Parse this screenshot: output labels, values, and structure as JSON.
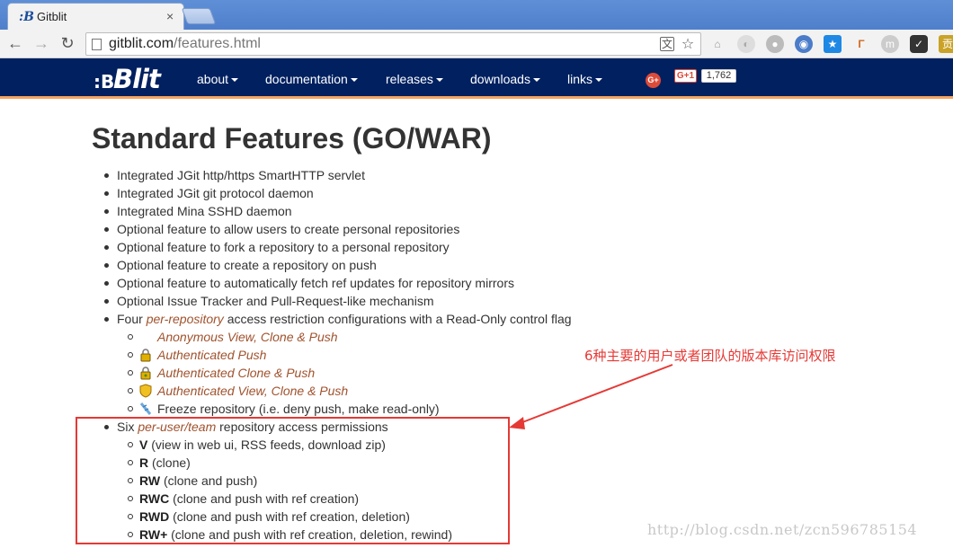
{
  "browser": {
    "tab_title": "Gitblit",
    "tab_close": "×",
    "url_host": "gitblit.com",
    "url_path": "/features.html"
  },
  "site": {
    "brand": "Blit",
    "brand_glyph": "☷",
    "menu": [
      {
        "label": "about"
      },
      {
        "label": "documentation"
      },
      {
        "label": "releases"
      },
      {
        "label": "downloads"
      },
      {
        "label": "links"
      }
    ],
    "gplus_icon": "G+",
    "gplus_button": "G+1",
    "gplus_count": "1,762"
  },
  "content": {
    "title": "Standard Features (GO/WAR)",
    "features": [
      "Integrated JGit http/https SmartHTTP servlet",
      "Integrated JGit git protocol daemon",
      "Integrated Mina SSHD daemon",
      "Optional feature to allow users to create personal repositories",
      "Optional feature to fork a repository to a personal repository",
      "Optional feature to create a repository on push",
      "Optional feature to automatically fetch ref updates for repository mirrors",
      "Optional Issue Tracker and Pull-Request-like mechanism"
    ],
    "per_repo": {
      "prefix": "Four ",
      "emph": "per-repository",
      "suffix": " access restriction configurations with a Read-Only control flag",
      "items": [
        {
          "label": "Anonymous View, Clone & Push",
          "icon": "none"
        },
        {
          "label": "Authenticated Push",
          "icon": "lock-icon"
        },
        {
          "label": "Authenticated Clone & Push",
          "icon": "lock-icon"
        },
        {
          "label": "Authenticated View, Clone & Push",
          "icon": "shield-icon"
        },
        {
          "label": "Freeze repository (i.e. deny push, make read-only)",
          "icon": "cold-icon"
        }
      ]
    },
    "per_user": {
      "prefix": "Six ",
      "emph": "per-user/team",
      "suffix": " repository access permissions",
      "items": [
        {
          "code": "V",
          "desc": " (view in web ui, RSS feeds, download zip)"
        },
        {
          "code": "R",
          "desc": " (clone)"
        },
        {
          "code": "RW",
          "desc": " (clone and push)"
        },
        {
          "code": "RWC",
          "desc": " (clone and push with ref creation)"
        },
        {
          "code": "RWD",
          "desc": " (clone and push with ref creation, deletion)"
        },
        {
          "code": "RW+",
          "desc": " (clone and push with ref creation, deletion, rewind)"
        }
      ]
    }
  },
  "annotation": {
    "text": "6种主要的用户或者团队的版本库访问权限",
    "color": "#e53935"
  },
  "watermark": "http://blog.csdn.net/zcn596785154"
}
